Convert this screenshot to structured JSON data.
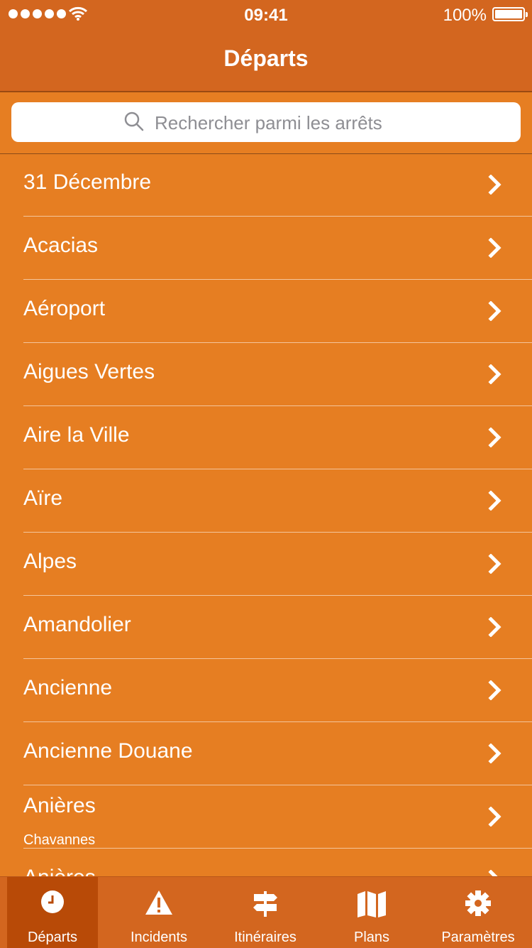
{
  "status": {
    "time": "09:41",
    "battery": "100%"
  },
  "nav": {
    "title": "Départs"
  },
  "search": {
    "placeholder": "Rechercher parmi les arrêts"
  },
  "stops": [
    {
      "name": "31 Décembre"
    },
    {
      "name": "Acacias"
    },
    {
      "name": "Aéroport"
    },
    {
      "name": "Aigues Vertes"
    },
    {
      "name": "Aire la Ville"
    },
    {
      "name": "Aïre"
    },
    {
      "name": "Alpes"
    },
    {
      "name": "Amandolier"
    },
    {
      "name": "Ancienne"
    },
    {
      "name": "Ancienne Douane"
    },
    {
      "name": "Anières",
      "sub": "Chavannes"
    },
    {
      "name": "Anières"
    }
  ],
  "tabs": [
    {
      "label": "Départs",
      "icon": "clock-icon",
      "active": true
    },
    {
      "label": "Incidents",
      "icon": "warning-icon"
    },
    {
      "label": "Itinéraires",
      "icon": "signpost-icon"
    },
    {
      "label": "Plans",
      "icon": "map-icon"
    },
    {
      "label": "Paramètres",
      "icon": "gear-icon"
    }
  ],
  "colors": {
    "background": "#E67E22",
    "bar": "#D3661F",
    "activeTab": "#B84A07"
  }
}
